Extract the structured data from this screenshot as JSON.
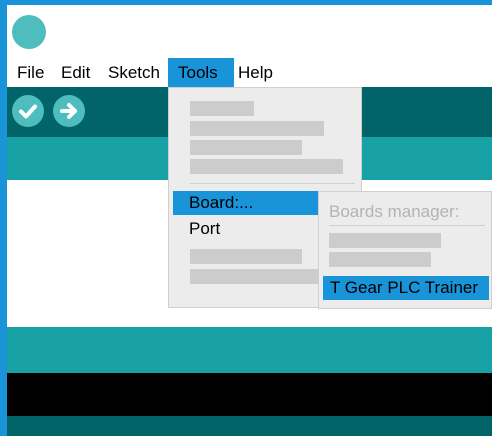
{
  "menubar": {
    "items": [
      {
        "label": "File"
      },
      {
        "label": "Edit"
      },
      {
        "label": "Sketch"
      },
      {
        "label": "Tools"
      },
      {
        "label": "Help"
      }
    ]
  },
  "toolbar": {
    "verify_icon": "checkmark-icon",
    "upload_icon": "arrow-right-icon"
  },
  "tools_menu": {
    "board_label": "Board:...",
    "port_label": "Port"
  },
  "board_submenu": {
    "header": "Boards manager:",
    "selected_board": "T Gear PLC Trainer"
  },
  "colors": {
    "frame": "#1a94d8",
    "teal_dark": "#006468",
    "teal": "#17a1a5",
    "teal_light": "#4dbdbd",
    "highlight": "#1a94d8",
    "menu_bg": "#ececec",
    "placeholder": "#cccccc"
  }
}
